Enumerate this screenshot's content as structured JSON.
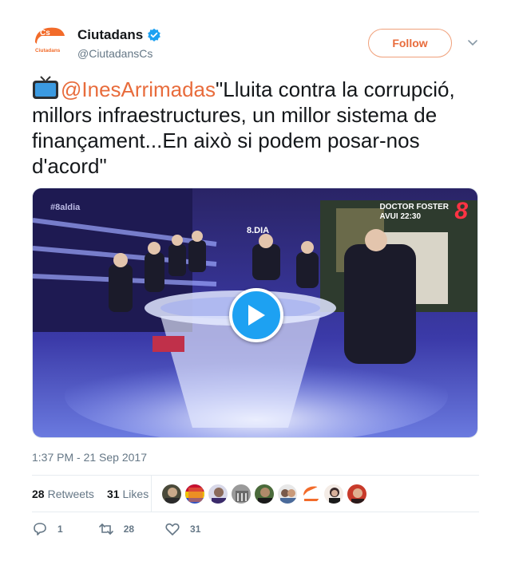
{
  "author": {
    "display_name": "Ciutadans",
    "handle": "@CiutadansCs",
    "verified": true,
    "avatar_text": "Ciutadans",
    "avatar_logo": "Cs"
  },
  "follow_label": "Follow",
  "tweet": {
    "emoji": "television-icon",
    "mention": "@InesArrimadas",
    "body": "\"Lluita contra la corrupció, millors infraestructures, un millor sistema de finançament...En això si podem posar-nos d'acord\""
  },
  "media": {
    "hashtag": "#8aldia",
    "promo_line1": "DOCTOR FOSTER",
    "promo_line2": "AVUI 22:30",
    "channel": "8",
    "studio_label": "8.DIA",
    "play_icon": "play-icon"
  },
  "timestamp": "1:37 PM - 21 Sep 2017",
  "stats": {
    "retweets_count": "28",
    "retweets_label": "Retweets",
    "likes_count": "31",
    "likes_label": "Likes"
  },
  "actions": {
    "reply_count": "1",
    "retweet_count": "28",
    "like_count": "31"
  },
  "colors": {
    "accent": "#e86c3c",
    "verified": "#1da1f2",
    "muted": "#657786"
  }
}
